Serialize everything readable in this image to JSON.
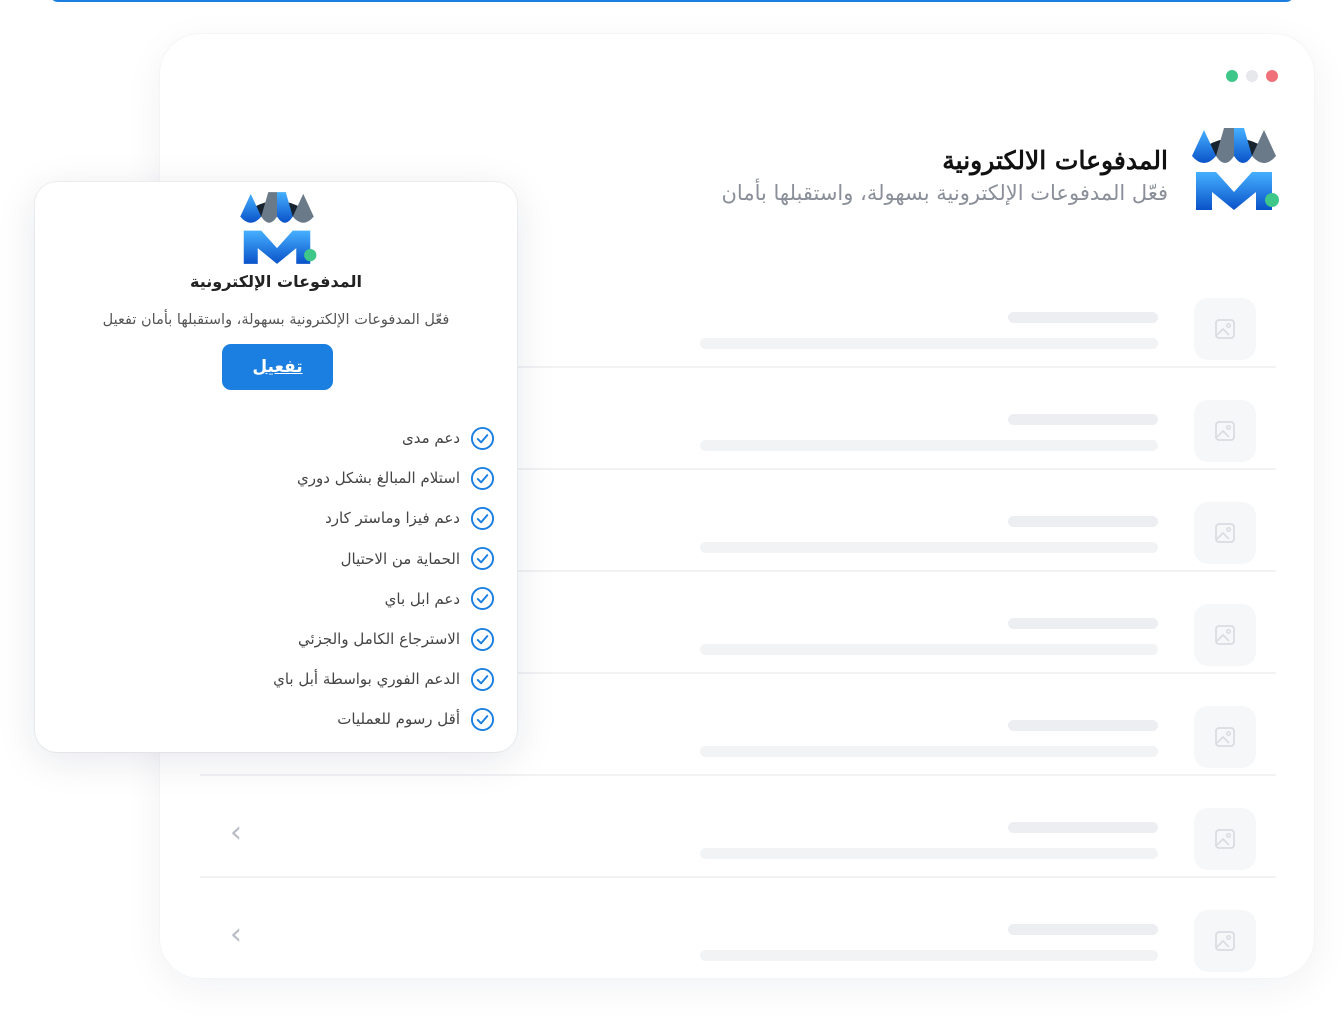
{
  "colors": {
    "accent": "#1a7fe0",
    "dot_green": "#3ec788",
    "dot_gray": "#e6e8ec",
    "dot_red": "#f0717a"
  },
  "header": {
    "logo_icon": "store-awning-logo-icon",
    "title": "المدفوعات الالكترونية",
    "subtitle": "فعّل المدفوعات الإلكترونية بسهولة، واستقبلها بأمان"
  },
  "list": {
    "rows": [
      {
        "thumb_icon": "image-placeholder-icon",
        "has_chevron": false
      },
      {
        "thumb_icon": "image-placeholder-icon",
        "has_chevron": false
      },
      {
        "thumb_icon": "image-placeholder-icon",
        "has_chevron": false
      },
      {
        "thumb_icon": "image-placeholder-icon",
        "has_chevron": false
      },
      {
        "thumb_icon": "image-placeholder-icon",
        "has_chevron": false
      },
      {
        "thumb_icon": "image-placeholder-icon",
        "has_chevron": true
      },
      {
        "thumb_icon": "image-placeholder-icon",
        "has_chevron": true
      }
    ],
    "chevron_glyph": "‹"
  },
  "popup": {
    "logo_icon": "store-awning-logo-icon",
    "title": "المدفوعات الإلكترونية",
    "subtitle": "فعّل المدفوعات الإلكترونية بسهولة، واستقبلها بأمان تفعيل",
    "activate_label": "تفعيل",
    "features": [
      "دعم مدى",
      "استلام المبالغ بشكل دوري",
      "دعم فيزا وماستر كارد",
      "الحماية من الاحتيال",
      "دعم ابل باي",
      "الاسترجاع الكامل والجزئي",
      "الدعم الفوري بواسطة أبل باي",
      "أقل رسوم للعمليات"
    ]
  }
}
